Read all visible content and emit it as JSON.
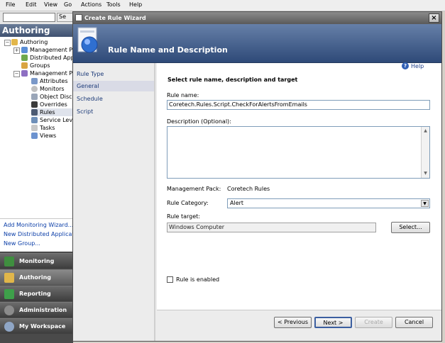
{
  "menubar": {
    "items": [
      "File",
      "Edit",
      "View",
      "Go",
      "Actions",
      "Tools",
      "Help"
    ]
  },
  "toolbar": {
    "search_button": "Se"
  },
  "left_pane": {
    "header": "Authoring",
    "tree": [
      {
        "label": "Authoring"
      },
      {
        "label": "Management Pack Templates"
      },
      {
        "label": "Distributed Applications"
      },
      {
        "label": "Groups"
      },
      {
        "label": "Management Pack Objects"
      },
      {
        "label": "Attributes"
      },
      {
        "label": "Monitors"
      },
      {
        "label": "Object Discoveries"
      },
      {
        "label": "Overrides"
      },
      {
        "label": "Rules"
      },
      {
        "label": "Service Level Tracking"
      },
      {
        "label": "Tasks"
      },
      {
        "label": "Views"
      }
    ],
    "tasks": [
      "Add Monitoring Wizard...",
      "New Distributed Application...",
      "New Group..."
    ],
    "wunderbar": [
      "Monitoring",
      "Authoring",
      "Reporting",
      "Administration",
      "My Workspace"
    ]
  },
  "dialog": {
    "title": "Create Rule Wizard",
    "banner_title": "Rule Name and Description",
    "nav": [
      "Rule Type",
      "General",
      "Schedule",
      "Script"
    ],
    "selected_nav": "General",
    "help_label": "Help",
    "section_title": "Select rule name, description and target",
    "rule_name_label": "Rule name:",
    "rule_name_value": "Coretech.Rules.Script.CheckForAlertsFromEmails",
    "description_label": "Description (Optional):",
    "description_value": "",
    "management_pack_label": "Management Pack:",
    "management_pack_value": "Coretech Rules",
    "rule_category_label": "Rule Category:",
    "rule_category_value": "Alert",
    "rule_target_label": "Rule target:",
    "rule_target_value": "Windows Computer",
    "select_button": "Select...",
    "enabled_label": "Rule is enabled",
    "enabled_checked": false,
    "buttons": {
      "previous": "< Previous",
      "next": "Next >",
      "create": "Create",
      "cancel": "Cancel"
    }
  },
  "colors": {
    "banner": "#2e4a78",
    "nav_selected": "#d9dbe6",
    "link": "#0b3ea8"
  }
}
